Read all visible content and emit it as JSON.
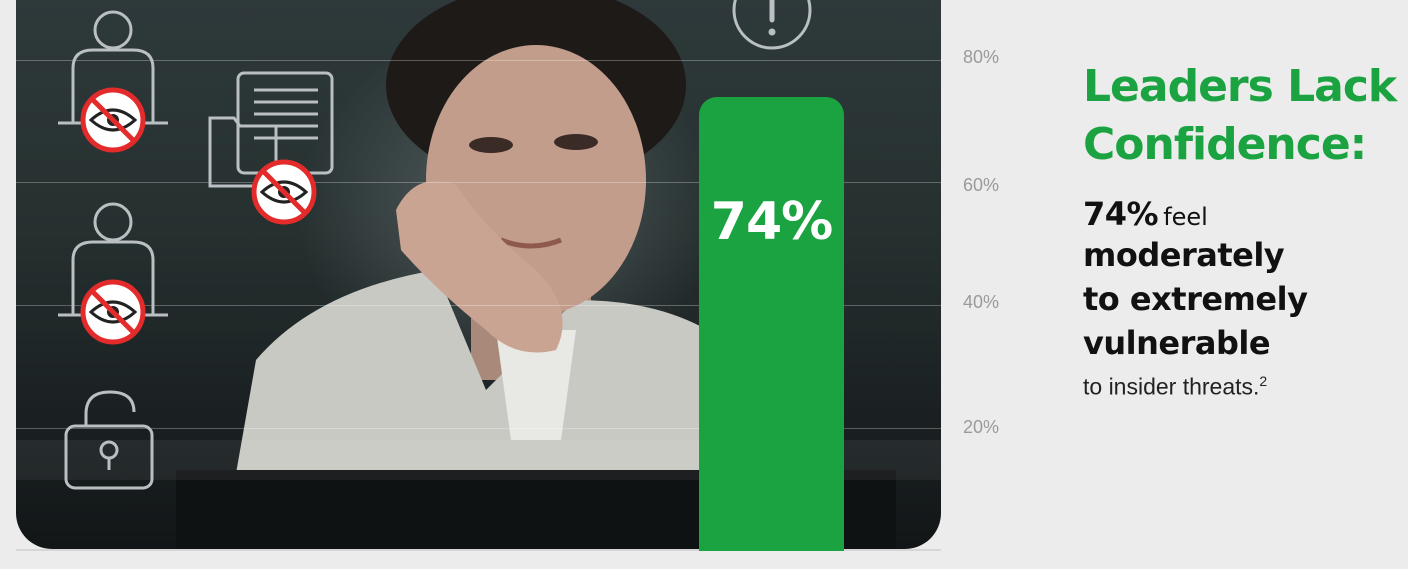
{
  "chart_data": {
    "type": "bar",
    "categories": [
      ""
    ],
    "values": [
      74
    ],
    "data_label": "74%",
    "yticks": [
      "20%",
      "40%",
      "60%",
      "80%"
    ],
    "ylim": [
      0,
      90
    ],
    "grid": true,
    "bar_color": "#1aa340"
  },
  "headline": {
    "line1": "Leaders Lack",
    "line2": "Confidence:"
  },
  "stat": {
    "value": "74%",
    "feel": "feel",
    "line1": "moderately",
    "line2": "to extremely",
    "line3": "vulnerable",
    "tail": "to insider threats.",
    "footnote": "2"
  },
  "colors": {
    "accent_green": "#1aa340",
    "background": "#ececec",
    "tick_gray": "#9a9a9a",
    "warning_red": "#e32b2b"
  },
  "icons": [
    "user-hidden-icon",
    "document-folder-hidden-icon",
    "alert-icon",
    "user-hidden-icon",
    "unlocked-padlock-icon"
  ]
}
